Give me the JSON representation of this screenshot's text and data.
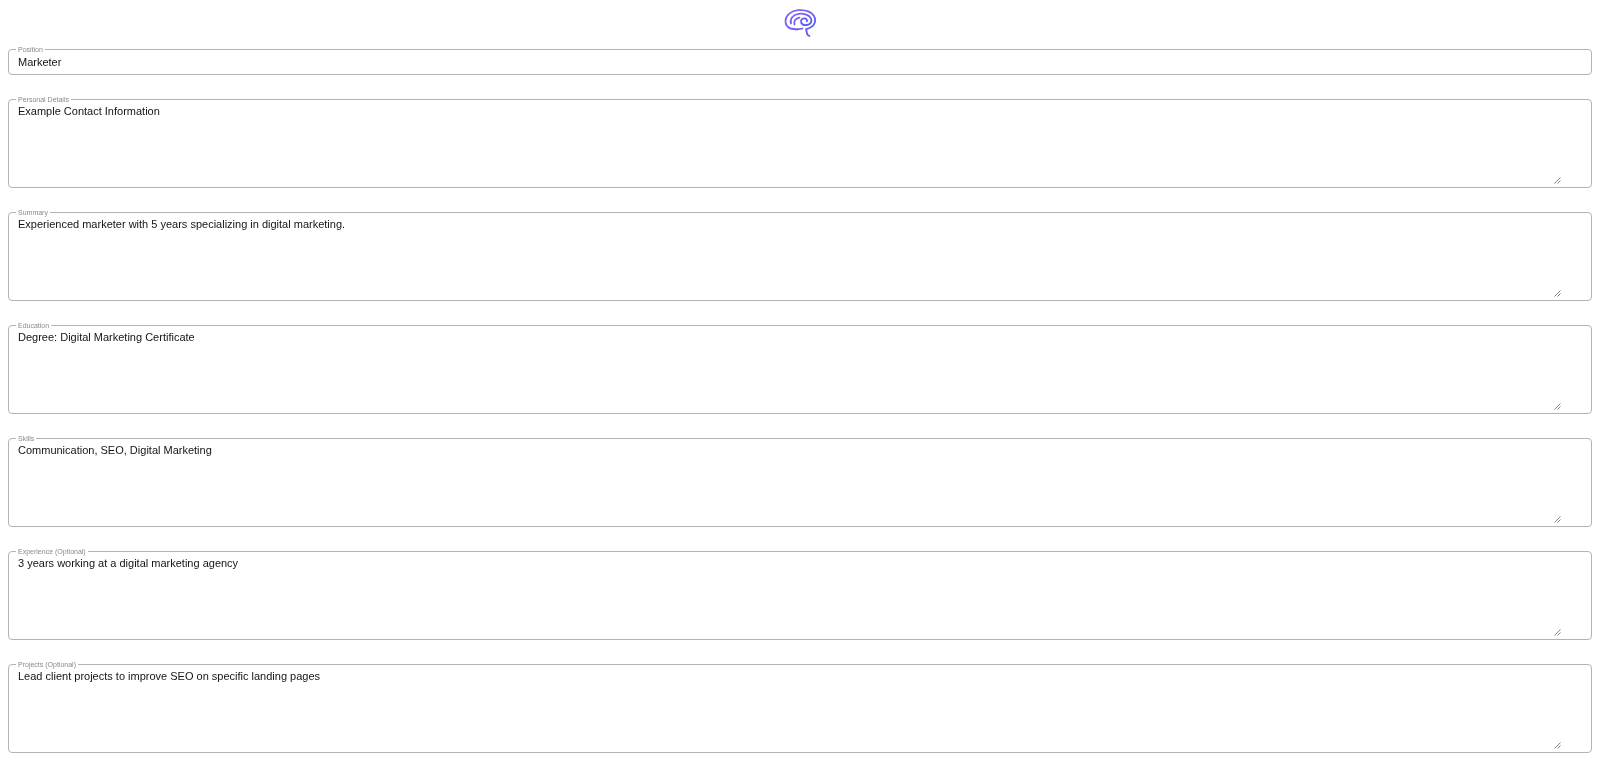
{
  "fields": [
    {
      "kind": "single",
      "label": "Position",
      "value": "Marketer"
    },
    {
      "kind": "multi",
      "label": "Personal Details",
      "value": "Example Contact Information"
    },
    {
      "kind": "multi",
      "label": "Summary",
      "value": "Experienced marketer with 5 years specializing in digital marketing."
    },
    {
      "kind": "multi",
      "label": "Education",
      "value": "Degree: Digital Marketing Certificate"
    },
    {
      "kind": "multi",
      "label": "Skills",
      "value": "Communication, SEO, Digital Marketing"
    },
    {
      "kind": "multi",
      "label": "Experience (Optional)",
      "value": "3 years working at a digital marketing agency"
    },
    {
      "kind": "multi",
      "label": "Projects (Optional)",
      "value": "Lead client projects to improve SEO on specific landing pages"
    }
  ]
}
